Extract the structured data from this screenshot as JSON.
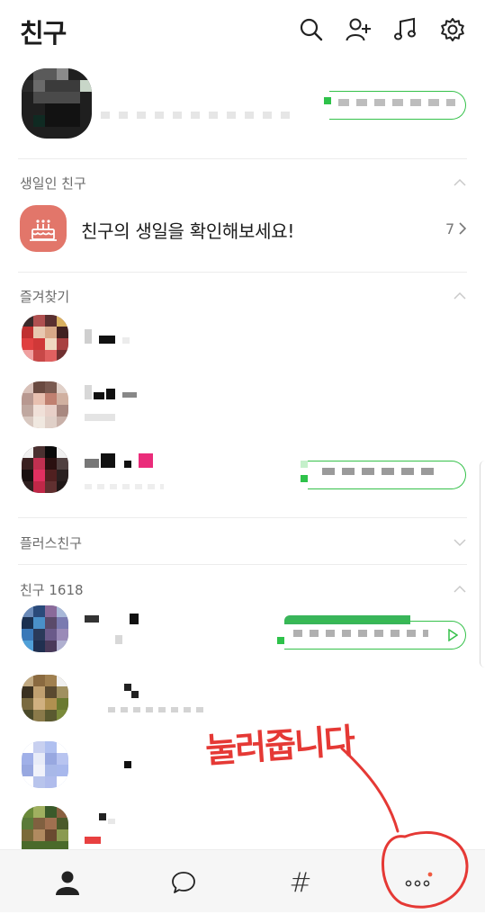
{
  "header": {
    "title": "친구",
    "icons": [
      "search-icon",
      "add-friend-icon",
      "music-icon",
      "settings-icon"
    ]
  },
  "sections": {
    "birthday": {
      "label": "생일인 친구"
    },
    "favorites": {
      "label": "즐겨찾기"
    },
    "plus_friends": {
      "label": "플러스친구"
    },
    "friends": {
      "label": "친구 1618"
    }
  },
  "birthday_banner": {
    "text": "친구의 생일을 확인해보세요!",
    "count": "7",
    "icon": "cake-icon"
  },
  "annotation": {
    "text": "눌러줍니다"
  },
  "bottom_nav": {
    "items": [
      "friends-icon",
      "chat-icon",
      "hashtag-icon",
      "more-icon"
    ],
    "hash_label": "#"
  },
  "colors": {
    "accent_green": "#35c14a",
    "birthday_bg": "#e2766a",
    "annotation_red": "#e53935"
  }
}
